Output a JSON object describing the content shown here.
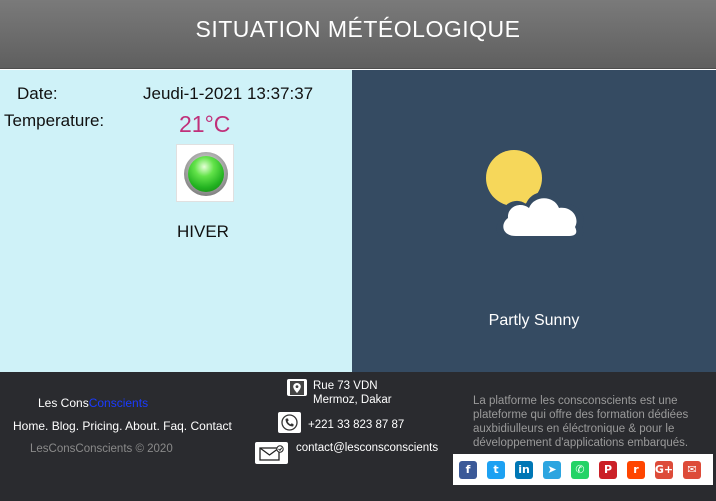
{
  "header": {
    "title": "SITUATION MÉTÉOLOGIQUE"
  },
  "left_panel": {
    "date_label": "Date:",
    "date_value": "Jeudi-1-2021 13:37:37",
    "temperature_label": "Temperature:",
    "temperature_value": "21°C",
    "indicator_icon": "green-led-icon",
    "season": "HIVER"
  },
  "right_panel": {
    "weather_icon": "partly-sunny-icon",
    "weather_text": "Partly Sunny"
  },
  "footer": {
    "brand_part1": "Les Cons",
    "brand_part2": "Conscients",
    "nav": {
      "home": "Home.",
      "blog": "Blog.",
      "pricing": "Pricing.",
      "about": "About.",
      "faq": "Faq.",
      "contact": "Contact"
    },
    "copyright": "LesConsConscients © 2020",
    "address_line1": "Rue 73 VDN",
    "address_line2": "Mermoz, Dakar",
    "phone": "+221 33 823 87 87",
    "email": "contact@lesconsconscients",
    "about_text": "La platforme les consconscients est une plateforme qui offre des formation  dédiées auxbidiulleurs en éléctronique & pour le développement d'applications embarqués.",
    "social": [
      {
        "icon": "facebook-icon",
        "glyph": "f",
        "color": "#3b5998"
      },
      {
        "icon": "twitter-icon",
        "glyph": "t",
        "color": "#1da1f2"
      },
      {
        "icon": "linkedin-icon",
        "glyph": "in",
        "color": "#0077b5"
      },
      {
        "icon": "telegram-icon",
        "glyph": "➤",
        "color": "#2ca5e0"
      },
      {
        "icon": "whatsapp-icon",
        "glyph": "✆",
        "color": "#25d366"
      },
      {
        "icon": "pinterest-icon",
        "glyph": "P",
        "color": "#cb2027"
      },
      {
        "icon": "reddit-icon",
        "glyph": "r",
        "color": "#ff4500"
      },
      {
        "icon": "google-plus-icon",
        "glyph": "G+",
        "color": "#dd4b39"
      },
      {
        "icon": "email-share-icon",
        "glyph": "✉",
        "color": "#dd4b39"
      }
    ]
  }
}
